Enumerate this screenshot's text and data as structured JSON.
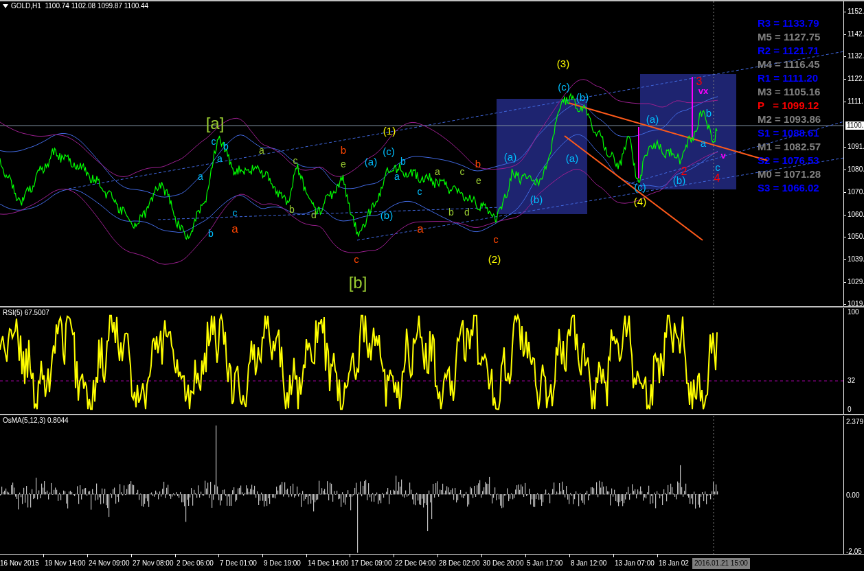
{
  "header": {
    "text": "GOLD,H1  1100.74 1102.08 1099.87 1100.44"
  },
  "price_axis": {
    "ticks": [
      "1152.",
      "1142.",
      "1132.",
      "1122.",
      "1111.",
      "1091.",
      "1080.",
      "1070.",
      "1060.",
      "1050.",
      "1039.",
      "1029.",
      "1019."
    ],
    "current_price": "1100."
  },
  "wave_labels": [
    {
      "text": "[a]",
      "color": "#9acd32"
    },
    {
      "text": "[b]",
      "color": "#9acd32"
    },
    {
      "text": "(1)",
      "color": "#ffff00"
    },
    {
      "text": "(2)",
      "color": "#ffff00"
    },
    {
      "text": "(3)",
      "color": "#ffff00"
    },
    {
      "text": "(4)",
      "color": "#ffff00"
    },
    {
      "text": "c",
      "color": "#00bfff"
    },
    {
      "text": "b",
      "color": "#00bfff"
    },
    {
      "text": "a",
      "color": "#00bfff"
    },
    {
      "text": "a",
      "color": "#00bfff"
    },
    {
      "text": "b",
      "color": "#00bfff"
    },
    {
      "text": "c",
      "color": "#00bfff"
    },
    {
      "text": "a",
      "color": "#ff4500"
    },
    {
      "text": "a",
      "color": "#9acd32"
    },
    {
      "text": "c",
      "color": "#9acd32"
    },
    {
      "text": "b",
      "color": "#9acd32"
    },
    {
      "text": "d",
      "color": "#9acd32"
    },
    {
      "text": "b",
      "color": "#ff4500"
    },
    {
      "text": "e",
      "color": "#9acd32"
    },
    {
      "text": "c",
      "color": "#ff4500"
    },
    {
      "text": "(a)",
      "color": "#00bfff"
    },
    {
      "text": "(c)",
      "color": "#00bfff"
    },
    {
      "text": "b",
      "color": "#00bfff"
    },
    {
      "text": "a",
      "color": "#00bfff"
    },
    {
      "text": "(b)",
      "color": "#00bfff"
    },
    {
      "text": "c",
      "color": "#00bfff"
    },
    {
      "text": "a",
      "color": "#ff4500"
    },
    {
      "text": "a",
      "color": "#9acd32"
    },
    {
      "text": "c",
      "color": "#9acd32"
    },
    {
      "text": "b",
      "color": "#9acd32"
    },
    {
      "text": "d",
      "color": "#9acd32"
    },
    {
      "text": "b",
      "color": "#ff4500"
    },
    {
      "text": "e",
      "color": "#9acd32"
    },
    {
      "text": "c",
      "color": "#ff4500"
    },
    {
      "text": "(a)",
      "color": "#00bfff"
    },
    {
      "text": "(b)",
      "color": "#00bfff"
    },
    {
      "text": "(c)",
      "color": "#00bfff"
    },
    {
      "text": "(b)",
      "color": "#00bfff"
    },
    {
      "text": "(a)",
      "color": "#00bfff"
    },
    {
      "text": "(a)",
      "color": "#00bfff"
    },
    {
      "text": "(c)",
      "color": "#00bfff"
    },
    {
      "text": "(b)",
      "color": "#00bfff"
    },
    {
      "text": "3",
      "color": "#ff0000"
    },
    {
      "text": "2",
      "color": "#ff0000"
    },
    {
      "text": "b",
      "color": "#00bfff"
    },
    {
      "text": "a",
      "color": "#00bfff"
    },
    {
      "text": "c",
      "color": "#00bfff"
    },
    {
      "text": "4",
      "color": "#ff0000"
    },
    {
      "text": "vx",
      "color": "#ff00ff"
    },
    {
      "text": "v",
      "color": "#ff00ff"
    }
  ],
  "pivot_levels": [
    {
      "text": "R3 = 1133.79",
      "color": "#0000ff"
    },
    {
      "text": "M5 = 1127.75",
      "color": "#808080"
    },
    {
      "text": "R2 = 1121.71",
      "color": "#0000ff"
    },
    {
      "text": "M4 = 1116.45",
      "color": "#808080"
    },
    {
      "text": "R1 = 1111.20",
      "color": "#0000ff"
    },
    {
      "text": "M3 = 1105.16",
      "color": "#808080"
    },
    {
      "text": "P   = 1099.12",
      "color": "#ff0000"
    },
    {
      "text": "M2 = 1093.86",
      "color": "#808080"
    },
    {
      "text": "S1 = 1088.61",
      "color": "#0000ff"
    },
    {
      "text": "M1 = 1082.57",
      "color": "#808080"
    },
    {
      "text": "S2 = 1076.53",
      "color": "#0000ff"
    },
    {
      "text": "M0 = 1071.28",
      "color": "#808080"
    },
    {
      "text": "S3 = 1066.02",
      "color": "#0000ff"
    }
  ],
  "rsi_panel": {
    "title": "RSI(5) 67.5007",
    "ticks": [
      "100",
      "32",
      "0"
    ]
  },
  "osma_panel": {
    "title": "OsMA(5,12,3) 0.8044",
    "ticks": [
      "2.379",
      "0.00",
      "-2.05"
    ]
  },
  "time_axis": {
    "labels": [
      "16 Nov 2015",
      "19 Nov 14:00",
      "24 Nov 09:00",
      "27 Nov 08:00",
      "2 Dec 06:00",
      "7 Dec 01:00",
      "9 Dec 19:00",
      "14 Dec 14:00",
      "17 Dec 09:00",
      "22 Dec 04:00",
      "28 Dec 02:00",
      "30 Dec 20:00",
      "5 Jan 17:00",
      "8 Jan 12:00",
      "13 Jan 07:00",
      "18 Jan 02"
    ],
    "cursor_label": "2016.01.21 15:00"
  }
}
